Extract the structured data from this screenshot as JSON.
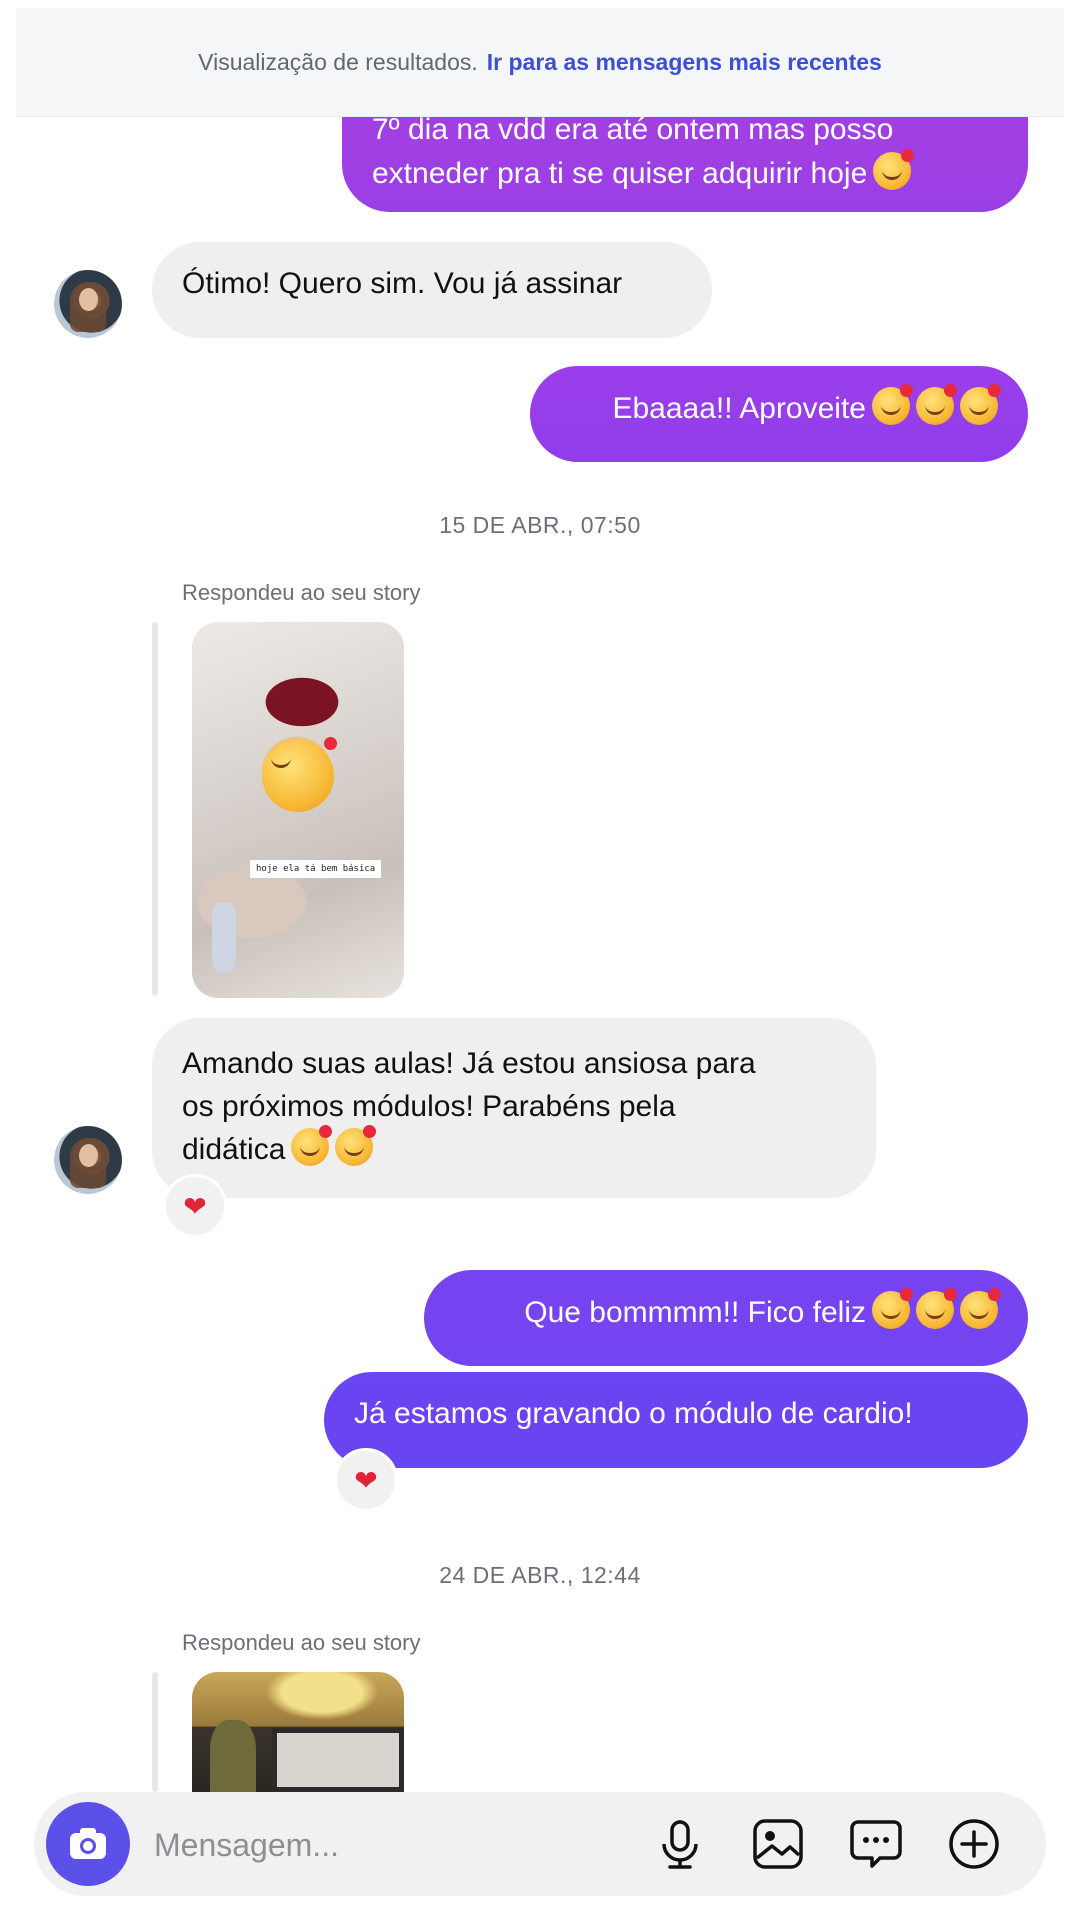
{
  "banner": {
    "text": "Visualização de resultados.",
    "link": "Ir para as mensagens mais recentes"
  },
  "messages": {
    "m1": {
      "line1": "7º dia na vdd era até ontem mas posso",
      "line2": "extneder pra ti se quiser adquirir hoje"
    },
    "m2": "Ótimo! Quero sim. Vou já assinar",
    "m3": "Ebaaaa!! Aproveite",
    "m4": {
      "line1": "Amando suas aulas! Já estou ansiosa para",
      "line2": "os próximos módulos! Parabéns pela",
      "line3": "didática"
    },
    "m5": "Que bommmm!! Fico feliz",
    "m6": "Já estamos gravando o módulo de cardio!"
  },
  "timestamps": [
    "15 DE ABR., 07:50",
    "24 DE ABR., 12:44"
  ],
  "story": {
    "label": "Respondeu ao seu story",
    "caption": "hoje ela tá bem básica"
  },
  "reactions": {
    "heart": "❤"
  },
  "composer": {
    "placeholder": "Mensagem..."
  },
  "icons": [
    "camera-icon",
    "microphone-icon",
    "gallery-icon",
    "sticker-chat-icon",
    "plus-circle-icon",
    "heart-icon",
    "emoji-icon"
  ],
  "colors": {
    "bubble_purple_top": "#a83fe0",
    "bubble_purple_mid": "#8b3df0",
    "bubble_violet_bottom": "#6a44f2",
    "incoming_bubble": "#efefef",
    "link": "#3d4fd6",
    "camera_button": "#5b51e8"
  }
}
